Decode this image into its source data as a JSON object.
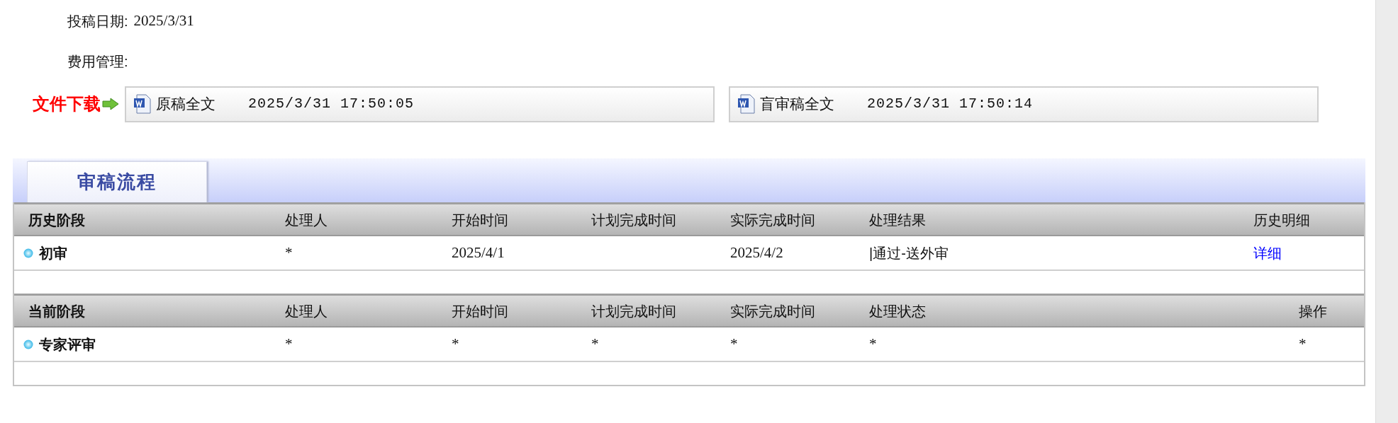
{
  "fields": [
    {
      "label": "投稿日期:",
      "value": "2025/3/31"
    },
    {
      "label": "费用管理:"
    }
  ],
  "downloads": {
    "label": "文件下载",
    "files": [
      {
        "name": "原稿全文",
        "time": "2025/3/31 17:50:05"
      },
      {
        "name": "盲审稿全文",
        "time": "2025/3/31 17:50:14"
      }
    ]
  },
  "tabs": [
    {
      "label": "审稿流程",
      "selected": true
    }
  ],
  "sections": [
    {
      "columns": [
        "历史阶段",
        "处理人",
        "开始时间",
        "计划完成时间",
        "实际完成时间",
        "处理结果",
        "历史明细"
      ],
      "rows": [
        {
          "cells": [
            {
              "kind": "stage",
              "text": "初审"
            },
            {
              "kind": "text",
              "text": "*"
            },
            {
              "kind": "text",
              "text": "2025/4/1"
            },
            {
              "kind": "empty"
            },
            {
              "kind": "text",
              "text": "2025/4/2"
            },
            {
              "kind": "text",
              "text": "|通过-送外审"
            },
            {
              "kind": "link",
              "text": "详细"
            }
          ]
        }
      ]
    },
    {
      "columns": [
        "当前阶段",
        "处理人",
        "开始时间",
        "计划完成时间",
        "实际完成时间",
        "处理状态",
        "操作"
      ],
      "rows": [
        {
          "cells": [
            {
              "kind": "stage",
              "text": "专家评审"
            },
            {
              "kind": "text",
              "text": "*"
            },
            {
              "kind": "text",
              "text": "*"
            },
            {
              "kind": "text",
              "text": "*"
            },
            {
              "kind": "text",
              "text": "*"
            },
            {
              "kind": "text",
              "text": "*"
            },
            {
              "kind": "text",
              "text": "*"
            }
          ]
        }
      ]
    }
  ]
}
